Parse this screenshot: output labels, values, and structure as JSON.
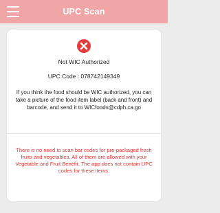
{
  "header": {
    "title": "UPC Scan",
    "menu_icon": "hamburger-menu-icon",
    "background_color": "#f0a6a6"
  },
  "result": {
    "status_icon": "error-x-circle-icon",
    "status_icon_color": "#e53b3b",
    "status_text": "Not WIC Authorized",
    "upc_label": "UPC Code :",
    "upc_value": "078742149349",
    "upc_line": "UPC Code :  078742149349",
    "instructions": "If you think the food should be WIC authorized, you can take a picture of the food item label (back and front) and barcode, and send it to WICfoods@cdph.ca.go"
  },
  "notice": {
    "text": "There is no need to scan bar codes for pre-packaged fresh fruits and vegetables. All of them are allowed with your Vegetable and Fruit Benefit. The app does not contain UPC codes for these items.",
    "color": "#e03030"
  }
}
